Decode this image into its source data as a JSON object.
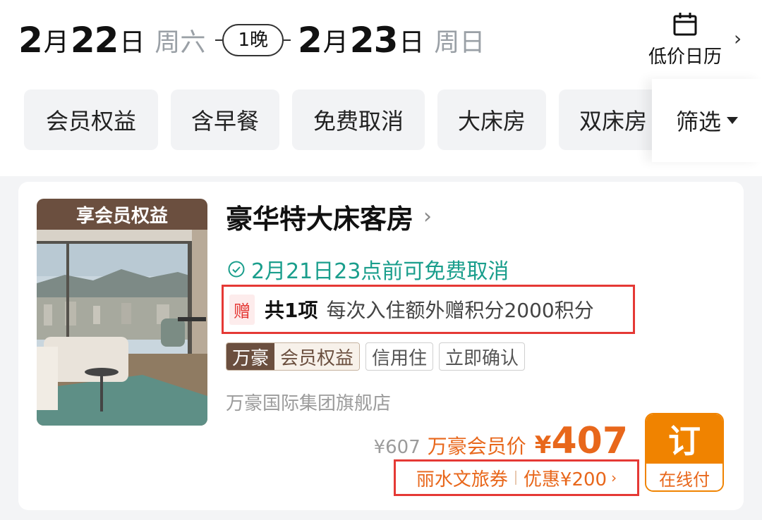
{
  "dates": {
    "checkin_day_num": "2",
    "checkin_month_unit": "月",
    "checkin_date_num": "22",
    "checkin_date_unit": "日",
    "checkin_weekday": "周六",
    "nights": "1晚",
    "checkout_day_num": "2",
    "checkout_month_unit": "月",
    "checkout_date_num": "23",
    "checkout_date_unit": "日",
    "checkout_weekday": "周日"
  },
  "calendar": {
    "label": "低价日历",
    "icon": "calendar-icon"
  },
  "filters": {
    "chips": [
      "会员权益",
      "含早餐",
      "免费取消",
      "大床房",
      "双床房"
    ],
    "filter_label": "筛选"
  },
  "room": {
    "badge": "享会员权益",
    "title": "豪华特大床客房",
    "cancel_policy": "2月21日23点前可免费取消",
    "gift_tag": "赠",
    "gift_count": "共1项",
    "gift_desc": "每次入住额外赠积分2000积分",
    "tags": {
      "brand": "万豪",
      "perk": "会员权益",
      "credit": "信用住",
      "confirm": "立即确认"
    },
    "store": "万豪国际集团旗舰店",
    "original_price": "¥607",
    "member_label": "万豪会员价",
    "currency": "¥",
    "price": "407",
    "coupon_name": "丽水文旅券",
    "coupon_discount": "优惠¥200",
    "book_label": "订",
    "book_sub": "在线付"
  },
  "colors": {
    "accent_orange": "#e8671b",
    "button_orange": "#f08300",
    "teal": "#1a9e8c",
    "highlight_red": "#e53935",
    "brand_brown": "#6b4f3f"
  }
}
